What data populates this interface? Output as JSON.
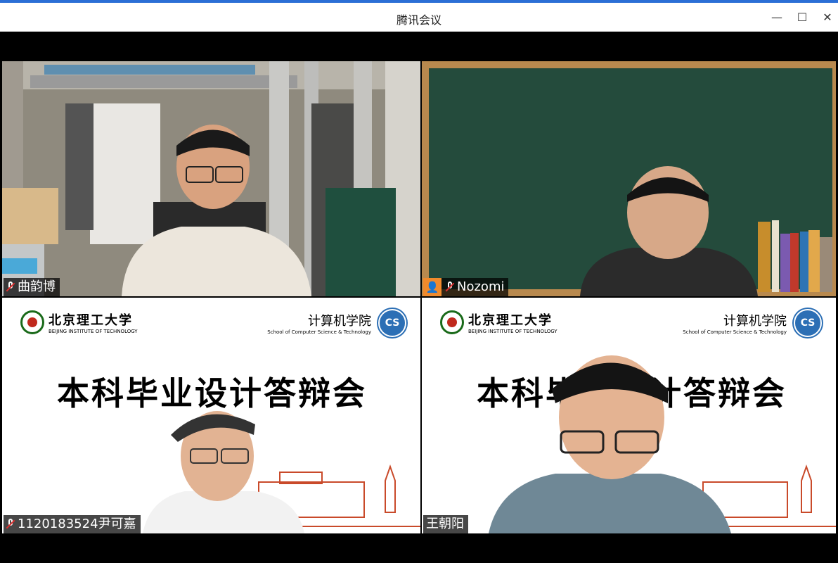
{
  "window": {
    "title": "腾讯会议",
    "controls": {
      "minimize": "—",
      "maximize": "☐",
      "close": "✕"
    }
  },
  "participants": [
    {
      "name": "曲韵博",
      "muted": true
    },
    {
      "name": "Nozomi",
      "muted": true,
      "has_avatar_badge": true
    },
    {
      "name": "1120183524尹可嘉",
      "muted": true
    },
    {
      "name": "王朝阳",
      "muted": false
    }
  ],
  "slide": {
    "university_cn": "北京理工大学",
    "university_en": "BEIJING INSTITUTE OF TECHNOLOGY",
    "school_cn": "计算机学院",
    "school_en": "School of Computer Science & Technology",
    "cs_logo": "CS",
    "title": "本科毕业设计答辩会"
  },
  "colors": {
    "accent_blue": "#2b6fd6",
    "mute_red": "#e03030",
    "avatar_orange": "#f08a2c",
    "bit_red": "#c0291d",
    "bit_green": "#1a6a1a",
    "cs_blue": "#2c6fb5"
  }
}
